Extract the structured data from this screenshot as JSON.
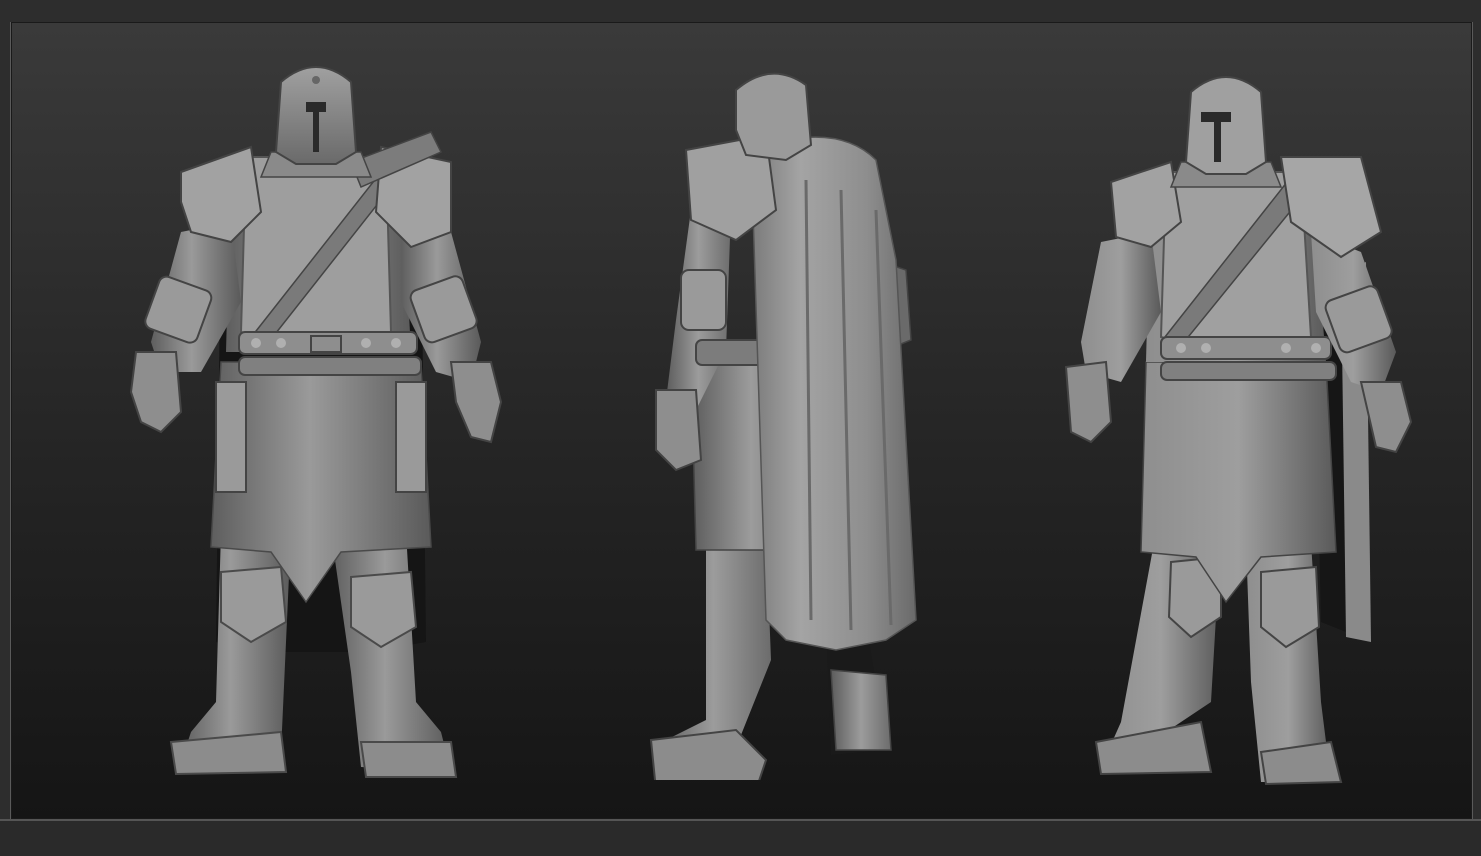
{
  "scene": {
    "views": [
      {
        "id": "front",
        "icon": "knight-sculpt-front-icon"
      },
      {
        "id": "back",
        "icon": "knight-sculpt-back-icon"
      },
      {
        "id": "three-quarter",
        "icon": "knight-sculpt-three-quarter-icon"
      }
    ],
    "colors": {
      "background_top": "#3a3a3a",
      "background_bottom": "#151515",
      "clay": "#8a8a8a",
      "clay_light": "#a8a8a8",
      "clay_dark": "#4a4a4a",
      "cloth_shadow": "#141414"
    }
  }
}
